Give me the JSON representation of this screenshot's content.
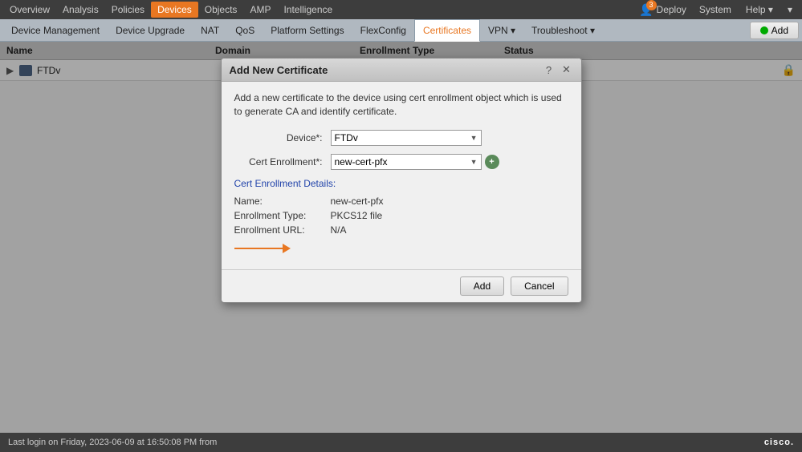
{
  "topNav": {
    "items": [
      {
        "label": "Overview",
        "active": false
      },
      {
        "label": "Analysis",
        "active": false
      },
      {
        "label": "Policies",
        "active": false
      },
      {
        "label": "Devices",
        "active": true
      },
      {
        "label": "Objects",
        "active": false
      },
      {
        "label": "AMP",
        "active": false
      },
      {
        "label": "Intelligence",
        "active": false
      }
    ],
    "rightItems": [
      {
        "label": "Deploy",
        "badge": "3"
      },
      {
        "label": "System"
      },
      {
        "label": "Help ▾"
      },
      {
        "label": "▾"
      }
    ]
  },
  "subNav": {
    "items": [
      {
        "label": "Device Management"
      },
      {
        "label": "Device Upgrade"
      },
      {
        "label": "NAT"
      },
      {
        "label": "QoS"
      },
      {
        "label": "Platform Settings"
      },
      {
        "label": "FlexConfig"
      },
      {
        "label": "Certificates",
        "active": true
      },
      {
        "label": "VPN ▾"
      },
      {
        "label": "Troubleshoot ▾"
      }
    ],
    "addButton": "Add"
  },
  "tableHeaders": {
    "name": "Name",
    "domain": "Domain",
    "enrollmentType": "Enrollment Type",
    "status": "Status"
  },
  "tableRows": [
    {
      "name": "FTDv",
      "domain": "",
      "enrollmentType": "",
      "status": "",
      "hasLock": true
    }
  ],
  "modal": {
    "title": "Add New Certificate",
    "description": "Add a new certificate to the device using cert enrollment object which is used to generate CA and identify certificate.",
    "deviceLabel": "Device*:",
    "deviceValue": "FTDv",
    "certEnrollmentLabel": "Cert Enrollment*:",
    "certEnrollmentValue": "new-cert-pfx",
    "certDetailsLink": "Cert Enrollment Details:",
    "detailName": {
      "label": "Name:",
      "value": "new-cert-pfx"
    },
    "detailEnrollmentType": {
      "label": "Enrollment Type:",
      "value": "PKCS12 file"
    },
    "detailEnrollmentUrl": {
      "label": "Enrollment URL:",
      "value": "N/A"
    },
    "addButton": "Add",
    "cancelButton": "Cancel"
  },
  "statusBar": {
    "text": "Last login on Friday, 2023-06-09 at 16:50:08 PM from",
    "logo": "cisco."
  },
  "icons": {
    "helpIcon": "?",
    "closeIcon": "✕",
    "questionIcon": "?",
    "lockIcon": "🔒",
    "plusIcon": "+"
  }
}
